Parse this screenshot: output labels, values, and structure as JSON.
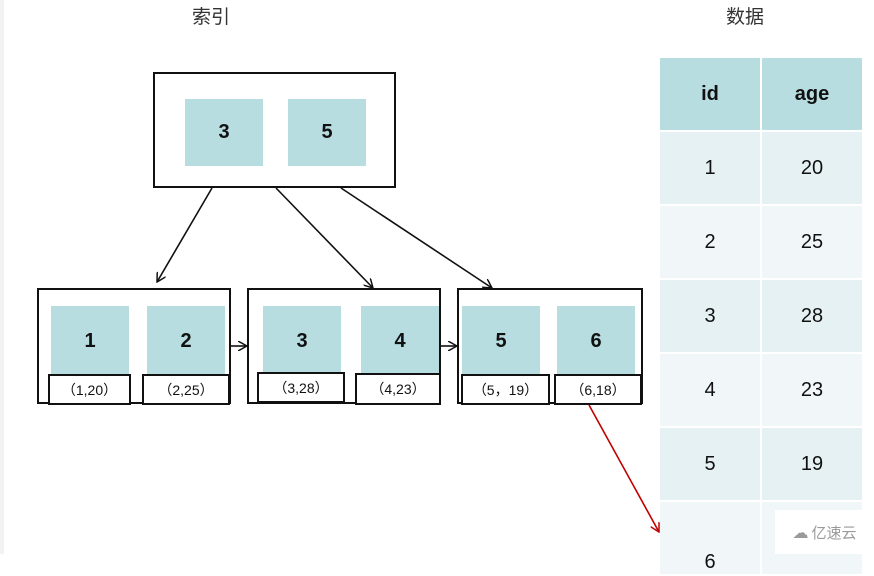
{
  "titles": {
    "index": "索引",
    "data": "数据"
  },
  "root": {
    "keys": [
      "3",
      "5"
    ]
  },
  "leaves": [
    {
      "keys": [
        "1",
        "2"
      ],
      "records": [
        "（1,20）",
        "（2,25）"
      ]
    },
    {
      "keys": [
        "3",
        "4"
      ],
      "records": [
        "（3,28）",
        "（4,23）"
      ]
    },
    {
      "keys": [
        "5",
        "6"
      ],
      "records": [
        "（5，19）",
        "（6,18）"
      ]
    }
  ],
  "table": {
    "headers": [
      "id",
      "age"
    ],
    "rows": [
      [
        "1",
        "20"
      ],
      [
        "2",
        "25"
      ],
      [
        "3",
        "28"
      ],
      [
        "4",
        "23"
      ],
      [
        "5",
        "19"
      ],
      [
        "6",
        ""
      ]
    ]
  },
  "colors": {
    "key_fill": "#b7dde1",
    "row_odd": "#e6f1f3",
    "row_even": "#f1f7f9",
    "pointer_arrow": "#c00000"
  },
  "watermark": "亿速云"
}
